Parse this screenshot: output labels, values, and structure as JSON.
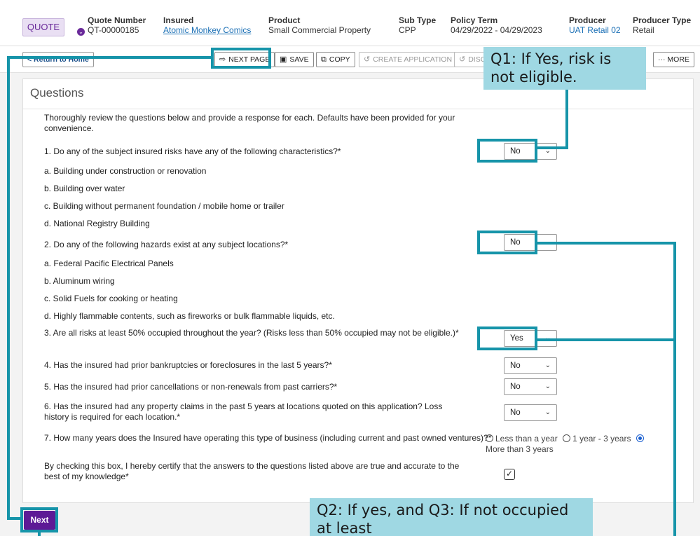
{
  "header": {
    "badge": "QUOTE",
    "cols": {
      "quote_number": {
        "label": "Quote Number",
        "value": "QT-00000185"
      },
      "insured": {
        "label": "Insured",
        "value": "Atomic Monkey Comics"
      },
      "product": {
        "label": "Product",
        "value": "Small Commercial Property"
      },
      "sub_type": {
        "label": "Sub Type",
        "value": "CPP"
      },
      "policy_term": {
        "label": "Policy Term",
        "value": "04/29/2022 - 04/29/2023"
      },
      "producer": {
        "label": "Producer",
        "value": "UAT Retail 02"
      },
      "producer_type": {
        "label": "Producer Type",
        "value": "Retail"
      }
    }
  },
  "toolbar": {
    "return_label": "< Return to Home",
    "next_page_label": "NEXT PAGE",
    "save_label": "SAVE",
    "copy_label": "COPY",
    "create_app_label": "CREATE APPLICATION",
    "discard_label": "DISC",
    "more_label": "··· MORE"
  },
  "questions": {
    "title": "Questions",
    "intro": "Thoroughly review the questions below and provide a response for each. Defaults have been provided for your convenience.",
    "q1": "1. Do any of the subject insured risks have any of the following characteristics?*",
    "q1_items": [
      "a. Building under construction or renovation",
      "b. Building over water",
      "c. Building without permanent foundation / mobile home or trailer",
      "d. National Registry Building"
    ],
    "q2": "2. Do any of the following hazards exist at any subject locations?*",
    "q2_items": [
      "a. Federal Pacific Electrical Panels",
      "b. Aluminum wiring",
      "c. Solid Fuels for cooking or heating",
      "d. Highly flammable contents, such as fireworks or bulk flammable liquids, etc."
    ],
    "q3": "3. Are all risks at least 50% occupied throughout the year? (Risks less than 50% occupied may not be eligible.)*",
    "q4": "4. Has the insured had prior bankruptcies or foreclosures in the last 5 years?*",
    "q5": "5. Has the insured had prior cancellations or non-renewals from past carriers?*",
    "q6": "6. Has the insured had any property claims in the past 5 years at locations quoted on this application? Loss history is required for each location.*",
    "q7": "7. How many years does the Insured have operating this type of business (including current and past owned ventures)?*",
    "certify": "By checking this box, I hereby certify that the answers to the questions listed above are true and accurate to the best of my knowledge*",
    "answers": {
      "q1": "No",
      "q2": "No",
      "q3": "Yes",
      "q4": "No",
      "q5": "No",
      "q6": "No"
    },
    "q7_options": [
      "Less than a year",
      "1 year - 3 years",
      "More than 3 years"
    ],
    "certified": true
  },
  "next_label": "Next",
  "annotations": {
    "callout1": "Q1: If Yes, risk is not eligible.",
    "callout2": "Q2: If yes, and Q3: If not occupied at least"
  }
}
